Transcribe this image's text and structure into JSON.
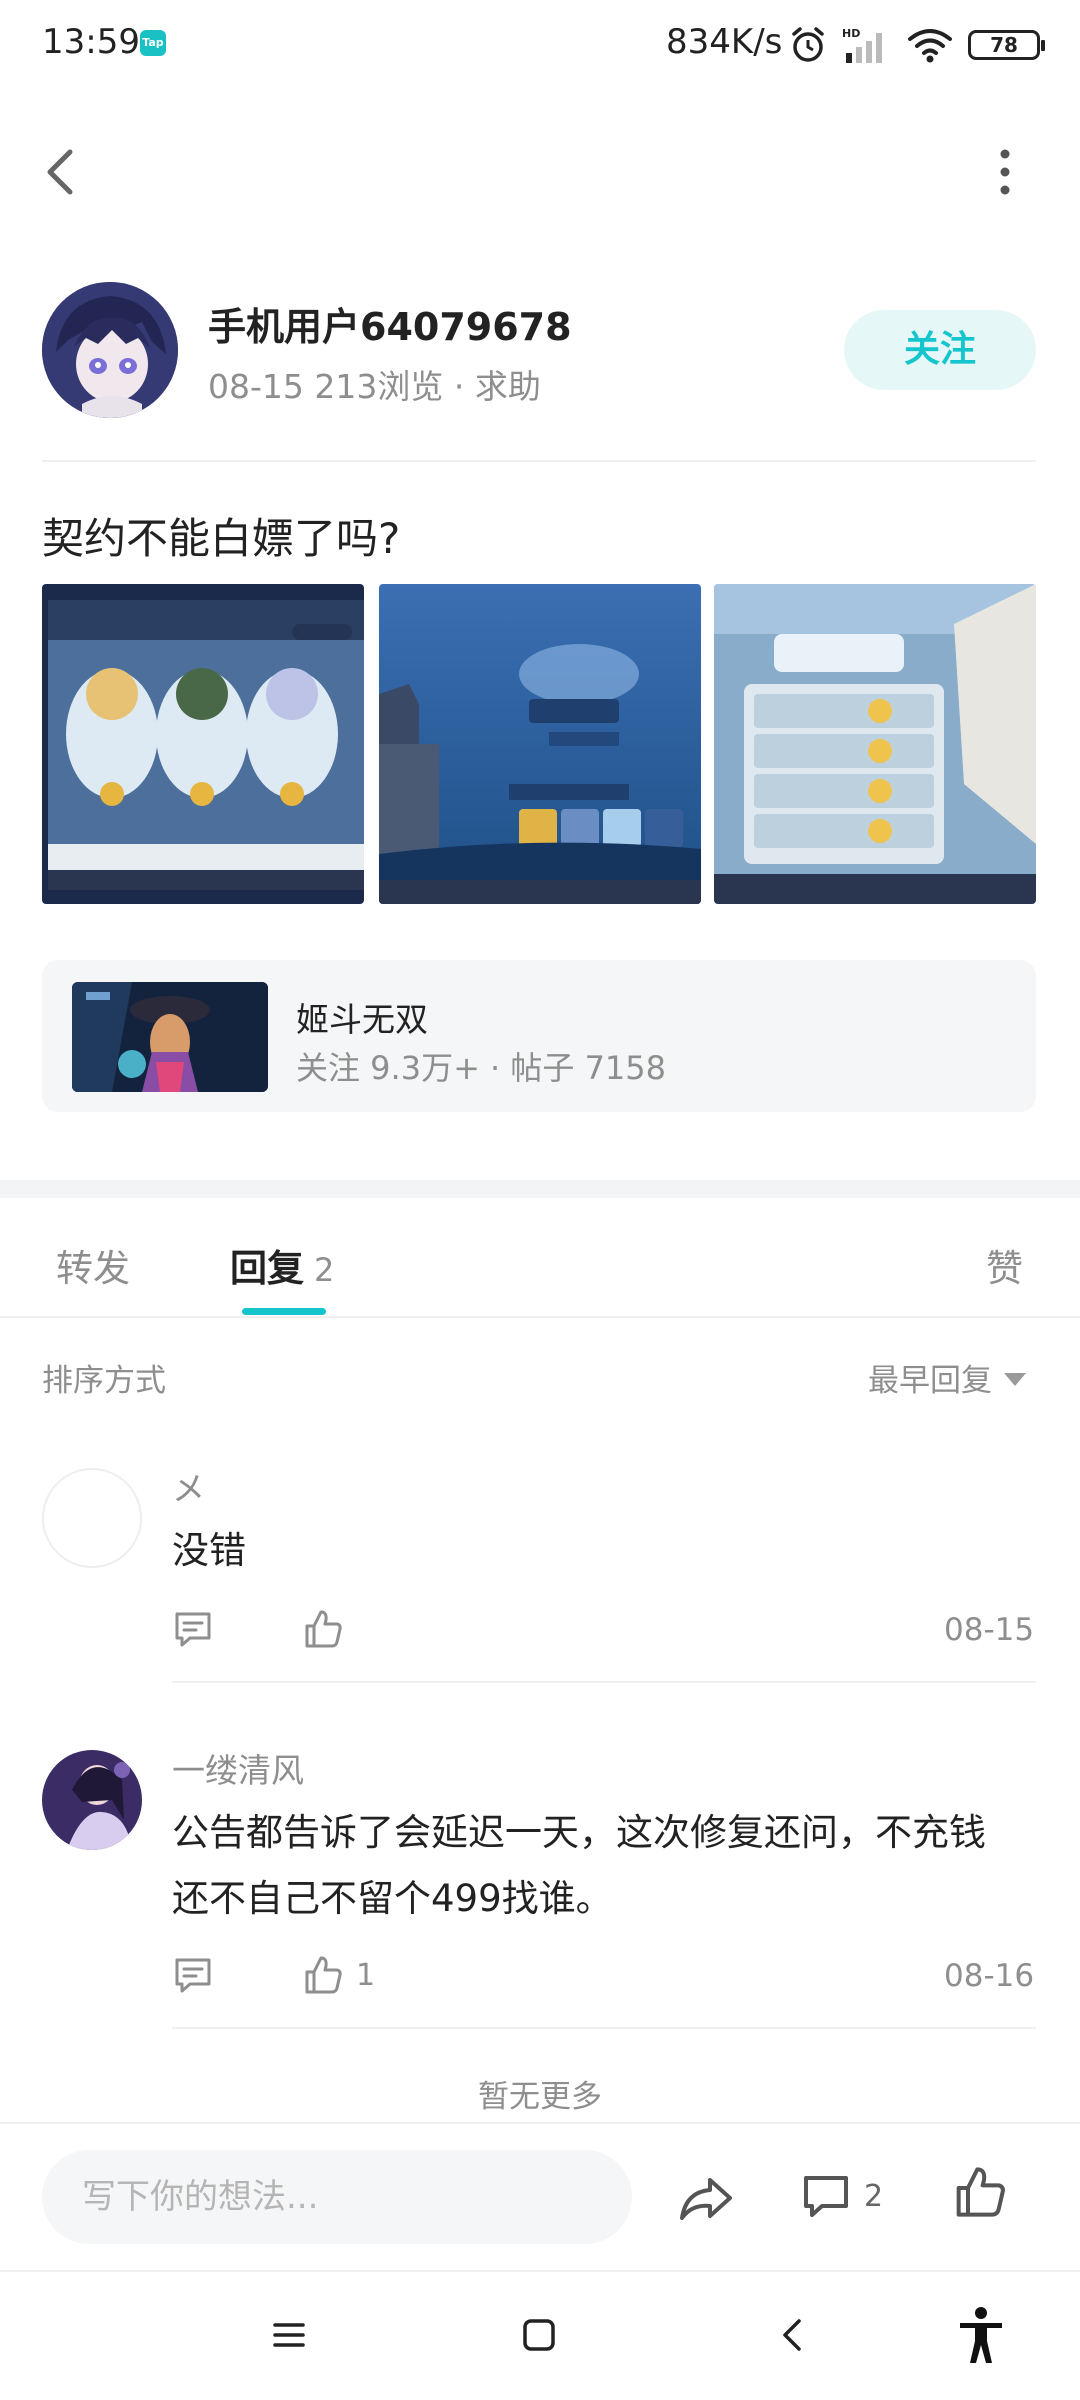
{
  "status_bar": {
    "time": "13:59",
    "app_badge": "Tap",
    "net_speed": "834K/s",
    "battery": "78",
    "icons": [
      "alarm-icon",
      "signal-icon",
      "wifi-icon",
      "battery-icon"
    ]
  },
  "header": {
    "back_icon": "chevron-left-icon",
    "more_icon": "more-vertical-icon"
  },
  "author": {
    "name": "手机用户64079678",
    "meta": "08-15  213浏览  ·  求助",
    "follow_label": "关注"
  },
  "post": {
    "title": "契约不能白嫖了吗?"
  },
  "game": {
    "name": "姬斗无双",
    "stats": "关注 9.3万+  ·  帖子 7158"
  },
  "tabs": {
    "repost": "转发",
    "reply": "回复",
    "reply_count": "2",
    "like": "赞"
  },
  "sort": {
    "label": "排序方式",
    "selected": "最早回复"
  },
  "comments": [
    {
      "name": "メ",
      "text": "没错",
      "likes": "",
      "date": "08-15"
    },
    {
      "name": "一缕清风",
      "text": "公告都告诉了会延迟一天，这次修复还问，不充钱还不自己不留个499找谁。",
      "likes": "1",
      "date": "08-16"
    }
  ],
  "no_more": "暂无更多",
  "bottom": {
    "input_placeholder": "写下你的想法...",
    "comment_count": "2"
  },
  "colors": {
    "accent": "#15c5ce",
    "follow_bg": "#e6f7f8",
    "muted_text": "#8e8e8e"
  }
}
